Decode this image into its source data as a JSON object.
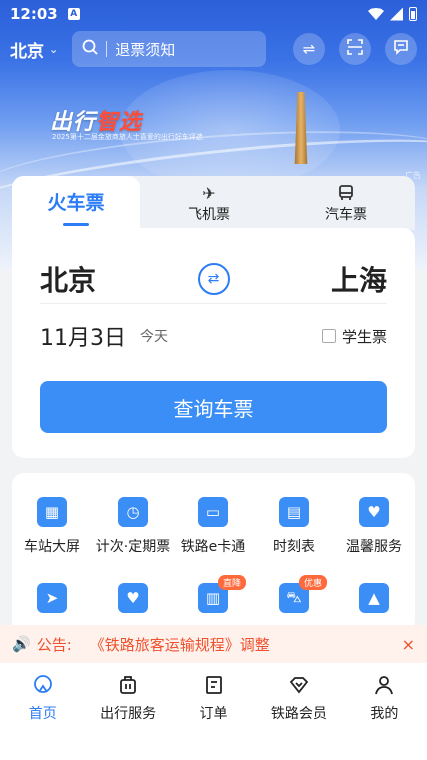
{
  "status_bar": {
    "time": "12:03",
    "app_letter": "A"
  },
  "header": {
    "city": "北京",
    "search_placeholder": "退票须知"
  },
  "banner": {
    "title_part1": "出行",
    "title_part2": "智选",
    "subtitle": "2025第十二届金旅商旅人士喜爱的出行好车评选",
    "ad_label": "广告"
  },
  "ticket_tabs": [
    {
      "label": "火车票",
      "icon": "train-icon",
      "active": true
    },
    {
      "label": "飞机票",
      "icon": "plane-icon",
      "active": false
    },
    {
      "label": "汽车票",
      "icon": "bus-icon",
      "active": false
    }
  ],
  "search_form": {
    "from_city": "北京",
    "to_city": "上海",
    "date": "11月3日",
    "date_note": "今天",
    "student_label": "学生票",
    "student_checked": false,
    "query_button": "查询车票"
  },
  "services": [
    {
      "label": "车站大屏",
      "icon": "station-screen-icon",
      "badge": ""
    },
    {
      "label": "计次·定期票",
      "icon": "pass-ticket-icon",
      "badge": ""
    },
    {
      "label": "铁路e卡通",
      "icon": "e-card-icon",
      "badge": ""
    },
    {
      "label": "时刻表",
      "icon": "timetable-icon",
      "badge": ""
    },
    {
      "label": "温馨服务",
      "icon": "care-service-icon",
      "badge": ""
    },
    {
      "label": "",
      "icon": "train-travel-icon",
      "badge": ""
    },
    {
      "label": "",
      "icon": "heart-icon",
      "badge": ""
    },
    {
      "label": "",
      "icon": "hotel-icon",
      "badge": "直降"
    },
    {
      "label": "",
      "icon": "car-icon",
      "badge": "优惠"
    },
    {
      "label": "",
      "icon": "mountain-icon",
      "badge": ""
    }
  ],
  "notice": {
    "label": "公告:",
    "text": "《铁路旅客运输规程》调整"
  },
  "bottom_nav": [
    {
      "label": "首页",
      "icon": "home-icon",
      "active": true
    },
    {
      "label": "出行服务",
      "icon": "luggage-icon",
      "active": false
    },
    {
      "label": "订单",
      "icon": "order-icon",
      "active": false
    },
    {
      "label": "铁路会员",
      "icon": "member-icon",
      "active": false
    },
    {
      "label": "我的",
      "icon": "profile-icon",
      "active": false
    }
  ],
  "colors": {
    "accent": "#2c7cf6",
    "button": "#3a8ef6",
    "notice": "#f0502e",
    "badge": "#ff6a3d"
  }
}
